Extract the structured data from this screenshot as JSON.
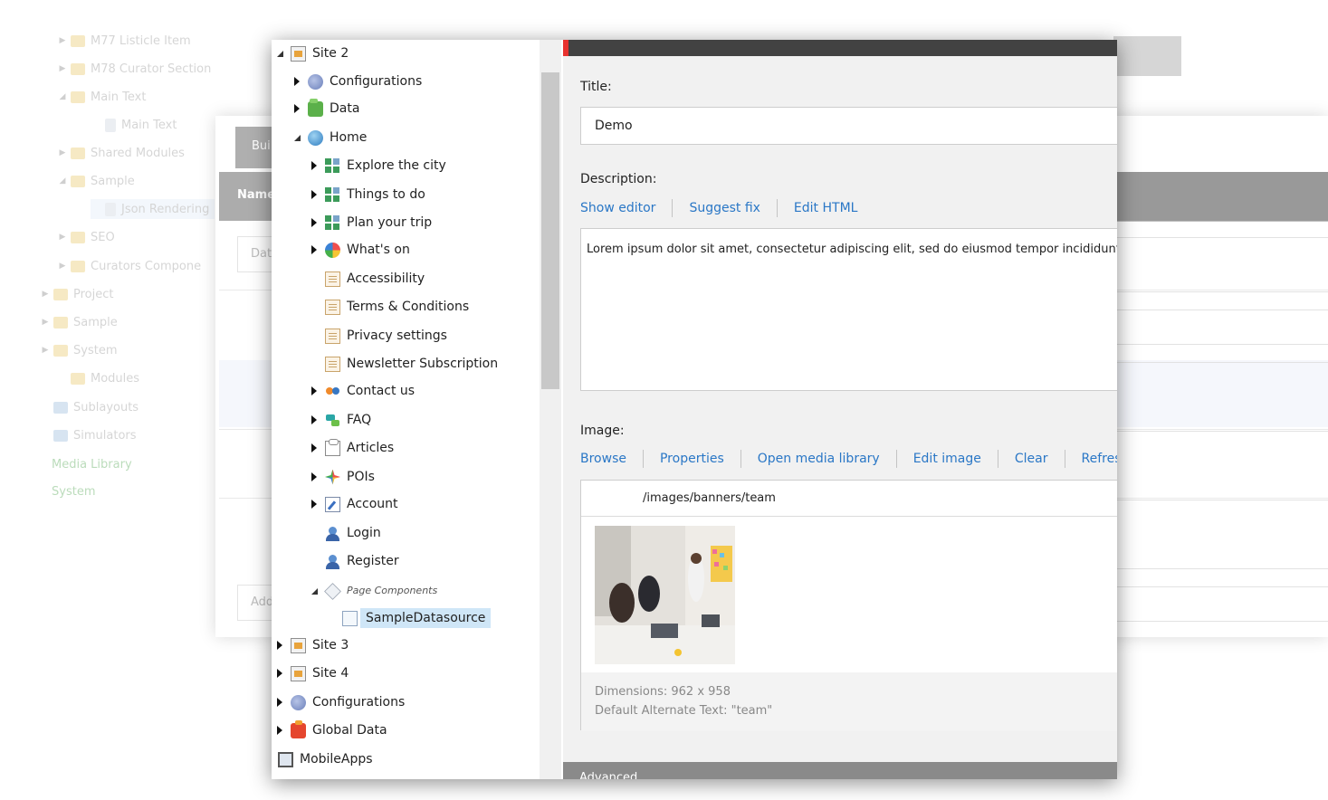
{
  "background_tree": [
    {
      "label": "M77 Listicle Item",
      "expander": "collapsed"
    },
    {
      "label": "M78 Curator Section",
      "expander": "collapsed"
    },
    {
      "label": "Main Text",
      "expander": "expanded"
    },
    {
      "label": "Main Text",
      "expander": "none"
    },
    {
      "label": "Shared Modules",
      "expander": "collapsed"
    },
    {
      "label": "Sample",
      "expander": "expanded"
    },
    {
      "label": "Json Rendering",
      "expander": "none"
    },
    {
      "label": "SEO",
      "expander": "collapsed"
    },
    {
      "label": "Curators Compone",
      "expander": "collapsed"
    },
    {
      "label": "Project",
      "expander": "collapsed"
    },
    {
      "label": "Sample",
      "expander": "collapsed"
    },
    {
      "label": "System",
      "expander": "collapsed"
    },
    {
      "label": "Modules",
      "expander": "none"
    },
    {
      "label": "Sublayouts",
      "expander": "none"
    },
    {
      "label": "Simulators",
      "expander": "none"
    },
    {
      "label": "Media Library",
      "expander": "none"
    },
    {
      "label": "System",
      "expander": "none"
    }
  ],
  "background_window": {
    "tab_label": "Bui",
    "header_label": "Name",
    "input1": "Dat",
    "input2": "Add"
  },
  "tree": {
    "nodes": [
      {
        "label": "Site 2",
        "icon": "site-icon",
        "expander": "expanded"
      },
      {
        "label": "Configurations",
        "icon": "configurations-icon",
        "expander": "collapsed"
      },
      {
        "label": "Data",
        "icon": "data-folder-icon",
        "expander": "collapsed"
      },
      {
        "label": "Home",
        "icon": "home-icon",
        "expander": "expanded"
      },
      {
        "label": "Explore the city",
        "icon": "grid-page-icon",
        "expander": "collapsed"
      },
      {
        "label": "Things to do",
        "icon": "grid-page-icon",
        "expander": "collapsed"
      },
      {
        "label": "Plan your trip",
        "icon": "grid-page-icon",
        "expander": "collapsed"
      },
      {
        "label": "What's on",
        "icon": "whats-on-icon",
        "expander": "collapsed"
      },
      {
        "label": "Accessibility",
        "icon": "document-icon",
        "expander": "none"
      },
      {
        "label": "Terms & Conditions",
        "icon": "document-icon",
        "expander": "none"
      },
      {
        "label": "Privacy settings",
        "icon": "document-icon",
        "expander": "none"
      },
      {
        "label": "Newsletter Subscription",
        "icon": "document-icon",
        "expander": "none"
      },
      {
        "label": "Contact us",
        "icon": "contact-icon",
        "expander": "collapsed"
      },
      {
        "label": "FAQ",
        "icon": "faq-icon",
        "expander": "collapsed"
      },
      {
        "label": "Articles",
        "icon": "articles-icon",
        "expander": "collapsed"
      },
      {
        "label": "POIs",
        "icon": "pois-icon",
        "expander": "collapsed"
      },
      {
        "label": "Account",
        "icon": "account-icon",
        "expander": "collapsed"
      },
      {
        "label": "Login",
        "icon": "user-icon",
        "expander": "none"
      },
      {
        "label": "Register",
        "icon": "user-icon",
        "expander": "none"
      },
      {
        "label": "Page Components",
        "icon": "page-components-icon",
        "expander": "expanded"
      },
      {
        "label": "SampleDatasource",
        "icon": "datasource-icon",
        "expander": "none",
        "selected": true
      },
      {
        "label": "Site 3",
        "icon": "site-icon",
        "expander": "collapsed"
      },
      {
        "label": "Site 4",
        "icon": "site-icon",
        "expander": "collapsed"
      },
      {
        "label": "Configurations",
        "icon": "configurations-icon",
        "expander": "collapsed"
      },
      {
        "label": "Global Data",
        "icon": "global-data-icon",
        "expander": "collapsed"
      },
      {
        "label": "MobileApps",
        "icon": "mobile-apps-icon",
        "expander": "none"
      }
    ]
  },
  "form": {
    "title_label": "Title:",
    "title_value": "Demo",
    "description_label": "Description:",
    "description_links": [
      "Show editor",
      "Suggest fix",
      "Edit HTML"
    ],
    "description_value": "Lorem ipsum dolor sit amet, consectetur adipiscing elit, sed do eiusmod tempor incididunt ut labore et dolore magna aliqua.",
    "image_label": "Image:",
    "image_links": [
      "Browse",
      "Properties",
      "Open media library",
      "Edit image",
      "Clear",
      "Refresh"
    ],
    "image_path": "/images/banners/team",
    "image_dimensions": "Dimensions: 962 x 958",
    "image_alt": "Default Alternate Text: \"team\"",
    "advanced_label": "Advanced"
  },
  "colors": {
    "link": "#2a77c6",
    "selection": "#cfe6f7",
    "topbar": "#424242",
    "topbar_accent": "#e8322f"
  }
}
